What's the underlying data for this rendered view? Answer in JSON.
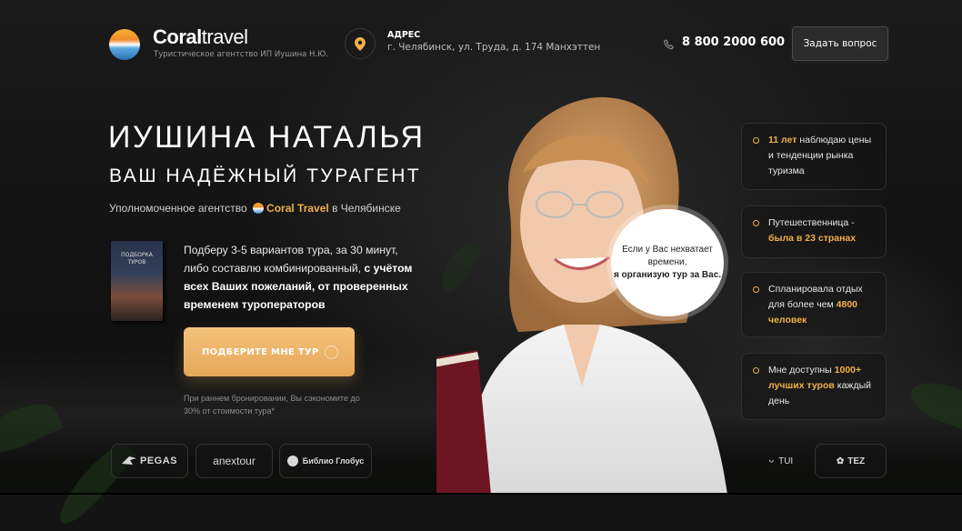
{
  "header": {
    "brand_bold": "Coral",
    "brand_light": "travel",
    "brand_sub": "Туристическое агентство ИП Иушина Н.Ю.",
    "address_label": "АДРЕС",
    "address_value": "г. Челябинск, ул. Труда, д. 174 Манхэттен",
    "phone": "8 800 2000 600",
    "ask_button": "Задать вопрос"
  },
  "hero": {
    "name": "ИУШИНА НАТАЛЬЯ",
    "subtitle": "ВАШ НАДЁЖНЫЙ ТУРАГЕНТ",
    "authorized_pre": "Уполномоченное агентство",
    "authorized_brand": "Coral Travel",
    "authorized_post": "в Челябинске",
    "book_title_1": "ПОДБОРКА",
    "book_title_2": "ТУРОВ",
    "offer_plain": "Подберу 3-5 вариантов тура, за 30 минут, либо составлю комбинированный,",
    "offer_bold": "с учётом всех Ваших пожеланий, от проверенных временем туроператоров",
    "cta_button": "ПОДБЕРИТЕ МНЕ ТУР",
    "note": "При раннем бронировании, Вы сэкономите до 30% от стоимости тура*"
  },
  "bubble": {
    "line1": "Если у Вас нехватает времени,",
    "line2": "я организую тур за Вас."
  },
  "facts": [
    {
      "bold": "11 лет",
      "text": "наблюдаю цены и тенденции рынка туризма"
    },
    {
      "text": "Путешественница -",
      "bold": "была в 23 странах"
    },
    {
      "text": "Спланировала отдых для более чем",
      "bold": "4800 человек"
    },
    {
      "text": "Мне доступны",
      "bold": "1000+ лучших туров",
      "text2": "каждый день"
    }
  ],
  "partners": [
    "PEGAS",
    "anextour",
    "Библио Глобус",
    "TUI",
    "TEZ"
  ],
  "colors": {
    "accent": "#f0b04a",
    "cta": "#e7a75a",
    "background": "#141414"
  }
}
